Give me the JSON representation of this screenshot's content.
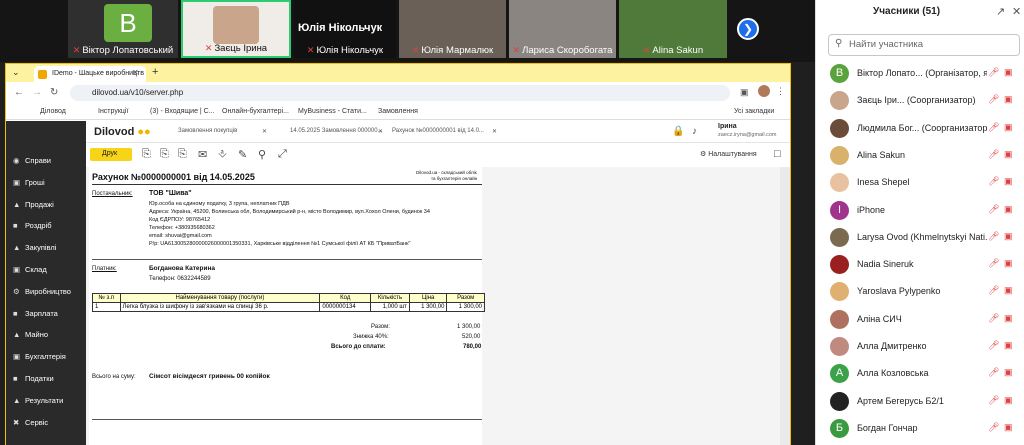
{
  "meeting": {
    "tiles": [
      {
        "name": "Віктор Лопатовський",
        "initial": "В"
      },
      {
        "name": "Заєць Ірина"
      },
      {
        "name": "Юлія Нікольчук",
        "overlay": "Юлія Нікольчук"
      },
      {
        "name": "Юлія Мармалюк"
      },
      {
        "name": "Лариса Скоробогата"
      },
      {
        "name": "Alina Sakun"
      }
    ]
  },
  "panel": {
    "title": "Учасники (51)",
    "search_placeholder": "Найти участника",
    "participants": [
      {
        "initial": "В",
        "color": "#5aa33c",
        "name": "Віктор Лопато... (Організатор, я)"
      },
      {
        "initial": "",
        "color": "#c9a58c",
        "name": "Заєць Іри... (Соорганизатор)"
      },
      {
        "initial": "",
        "color": "#6b4b3a",
        "name": "Людмила Бог... (Соорганизатор)"
      },
      {
        "initial": "",
        "color": "#d8b16a",
        "name": "Alina Sakun"
      },
      {
        "initial": "",
        "color": "#e8c2a0",
        "name": "Inesa Shepel"
      },
      {
        "initial": "I",
        "color": "#a0348c",
        "name": "iPhone"
      },
      {
        "initial": "",
        "color": "#7a6a50",
        "name": "Larysa Ovod (Khmelnytskyi Nati..."
      },
      {
        "initial": "",
        "color": "#9a2020",
        "name": "Nadia Sineruk"
      },
      {
        "initial": "",
        "color": "#e0b070",
        "name": "Yaroslava Pylypenko"
      },
      {
        "initial": "",
        "color": "#b07060",
        "name": "Аліна СИЧ"
      },
      {
        "initial": "",
        "color": "#c08a80",
        "name": "Алла Дмитренко"
      },
      {
        "initial": "А",
        "color": "#3ba24a",
        "name": "Алла Козловська"
      },
      {
        "initial": "",
        "color": "#222222",
        "name": "Артем Бегерусь Б2/1"
      },
      {
        "initial": "Б",
        "color": "#3a9a40",
        "name": "Богдан Гончар"
      }
    ]
  },
  "browser": {
    "tab_title": "IDemo - Шацьке виробництв",
    "url": "dilovod.ua/v10/server.php",
    "bookmarks": [
      "Діловод",
      "Інструкції",
      "(3) - Входящие | С...",
      "Онлайн-бухгалтері...",
      "MyBusiness - Стати...",
      "Замовлення",
      "Усі закладки"
    ]
  },
  "app": {
    "logo": "Dilovod",
    "doc_tabs": [
      "Замовлення покупців",
      "14.05.2025 Замовлення 000000...",
      "Рахунок №0000000001 від 14.0..."
    ],
    "user_name": "Ірина",
    "user_email": "zaecz.iryna@gmail.com",
    "sidebar": [
      "Справи",
      "Гроші",
      "Продажі",
      "Роздріб",
      "Закупівлі",
      "Склад",
      "Виробництво",
      "Зарплата",
      "Майно",
      "Бухгалтерія",
      "Податки",
      "Результати",
      "Сервіс"
    ],
    "print_label": "Друк",
    "settings_label": "Налаштування"
  },
  "invoice": {
    "title": "Рахунок №0000000001 від 14.05.2025",
    "brand_note_1": "Dilovod.ua - складський облік",
    "brand_note_2": "та бухгалтерія онлайн",
    "supplier_label": "Постачальник:",
    "supplier_name": "ТОВ \"Шива\"",
    "supplier_lines": [
      "Юр.особа на єдиному податку, 3 група, неплатник ПДВ",
      "Адреса: Україна, 45200, Волинська обл, Володимирський р-н, місто Володимир, вул.Хохол Олени, будинок 34",
      "Код ЄДРПОУ: 98765412",
      "Телефон: +380935680362",
      "email: shuvai@gmail.com",
      "Р/р: UA613005280000026000001350331, Харківське відділення №1 Сумської філії АТ КБ \"ПриватБанк\""
    ],
    "payer_label": "Платник:",
    "payer_name": "Богданова Катерина",
    "payer_phone": "Телефон: 0632244589",
    "columns": [
      "№ з.п",
      "Найменування товару (послуги)",
      "Код",
      "Кількість",
      "Ціна",
      "Разом"
    ],
    "rows": [
      [
        "1",
        "Легка блузка із шифону із зав'язками на спинці 36 р.",
        "0000000134",
        "1,000 шт",
        "1 300,00",
        "1 300,00"
      ]
    ],
    "total_label": "Разом:",
    "total_value": "1 300,00",
    "discount_label": "Знижка 40%:",
    "discount_value": "520,00",
    "due_label": "Всього до сплати:",
    "due_value": "780,00",
    "words_label": "Всього на суму:",
    "words_value": "Сімсот вісімдесят гривень 00 копійок"
  }
}
